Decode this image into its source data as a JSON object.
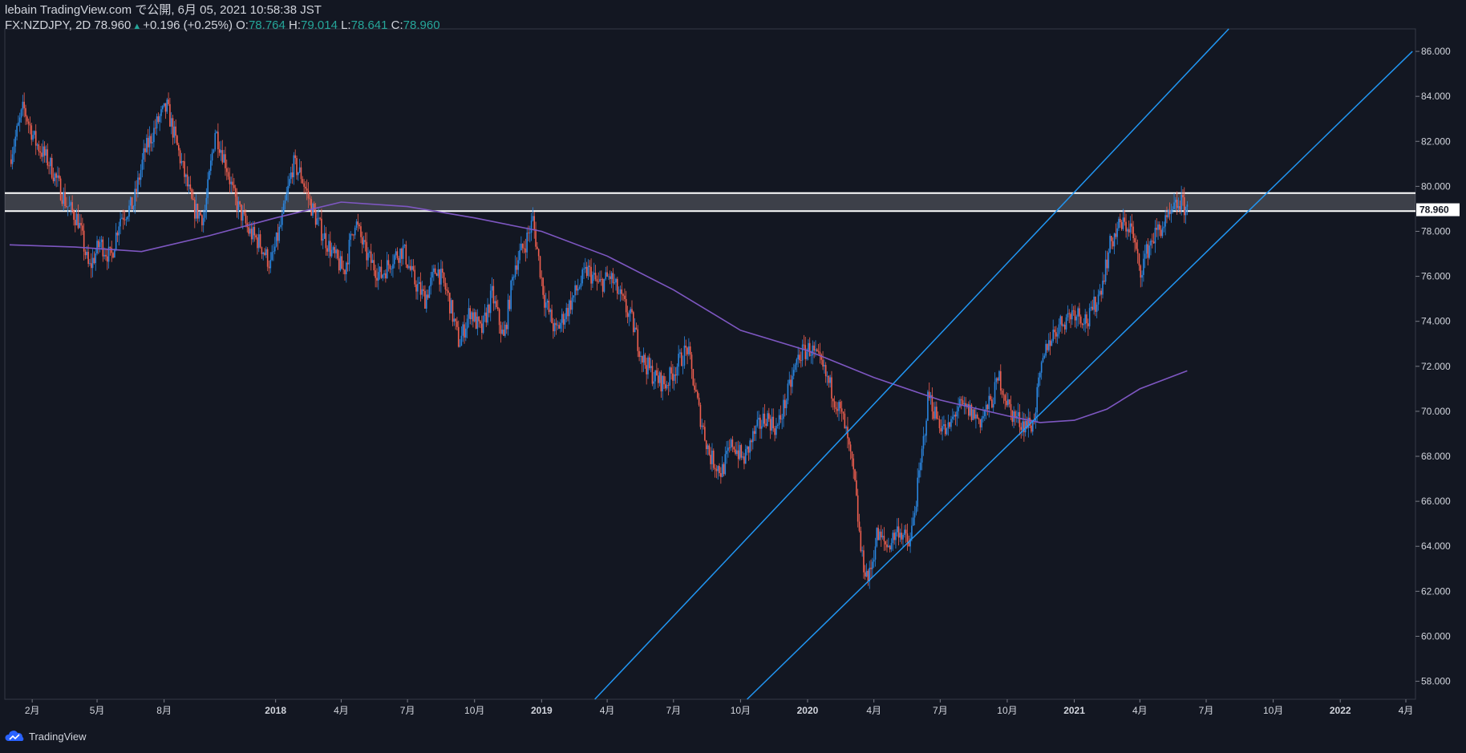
{
  "header": {
    "line1": "lebain TradingView.com で公開, 6月 05, 2021 10:58:38 JST",
    "symbol_tf": "FX:NZDJPY, 2D",
    "last": "78.960",
    "change": "+0.196 (+0.25%)",
    "o_label": "O:",
    "o_val": "78.764",
    "h_label": "H:",
    "h_val": "79.014",
    "l_label": "L:",
    "l_val": "78.641",
    "c_label": "C:",
    "c_val": "78.960"
  },
  "brand": "TradingView",
  "chart_data": {
    "type": "candlestick",
    "x_tick_labels": [
      "2月",
      "5月",
      "8月",
      "2018",
      "4月",
      "7月",
      "10月",
      "2019",
      "4月",
      "7月",
      "10月",
      "2020",
      "4月",
      "7月",
      "10月",
      "2021",
      "4月",
      "7月",
      "10月",
      "2022",
      "4月"
    ],
    "y_tick_labels": [
      "86.000",
      "84.000",
      "82.000",
      "80.000",
      "78.000",
      "76.000",
      "74.000",
      "72.000",
      "70.000",
      "68.000",
      "66.000",
      "64.000",
      "62.000",
      "60.000",
      "58.000"
    ],
    "ylim": [
      57.2,
      87.0
    ],
    "current_price_label": "78.960",
    "close_path": [
      [
        "2017-01-01",
        81.2
      ],
      [
        "2017-01-20",
        83.5
      ],
      [
        "2017-02-05",
        82.0
      ],
      [
        "2017-02-25",
        81.0
      ],
      [
        "2017-03-20",
        79.2
      ],
      [
        "2017-04-05",
        78.5
      ],
      [
        "2017-04-20",
        76.3
      ],
      [
        "2017-05-05",
        77.5
      ],
      [
        "2017-05-20",
        76.8
      ],
      [
        "2017-06-01",
        78.6
      ],
      [
        "2017-06-20",
        79.2
      ],
      [
        "2017-07-05",
        81.5
      ],
      [
        "2017-07-25",
        83.0
      ],
      [
        "2017-08-05",
        83.5
      ],
      [
        "2017-08-25",
        81.0
      ],
      [
        "2017-09-10",
        79.0
      ],
      [
        "2017-09-25",
        78.6
      ],
      [
        "2017-10-10",
        82.5
      ],
      [
        "2017-10-25",
        81.0
      ],
      [
        "2017-11-05",
        79.5
      ],
      [
        "2017-11-25",
        78.0
      ],
      [
        "2017-12-10",
        77.5
      ],
      [
        "2017-12-25",
        76.5
      ],
      [
        "2018-01-10",
        78.5
      ],
      [
        "2018-01-25",
        81.0
      ],
      [
        "2018-02-05",
        80.5
      ],
      [
        "2018-02-20",
        79.0
      ],
      [
        "2018-03-05",
        78.0
      ],
      [
        "2018-03-20",
        77.0
      ],
      [
        "2018-04-05",
        76.2
      ],
      [
        "2018-04-20",
        78.5
      ],
      [
        "2018-05-05",
        77.0
      ],
      [
        "2018-05-25",
        76.0
      ],
      [
        "2018-06-10",
        76.8
      ],
      [
        "2018-06-25",
        77.2
      ],
      [
        "2018-07-10",
        75.8
      ],
      [
        "2018-07-25",
        75.0
      ],
      [
        "2018-08-10",
        76.4
      ],
      [
        "2018-08-25",
        75.2
      ],
      [
        "2018-09-10",
        73.0
      ],
      [
        "2018-09-25",
        74.5
      ],
      [
        "2018-10-10",
        73.5
      ],
      [
        "2018-10-25",
        75.2
      ],
      [
        "2018-11-10",
        73.2
      ],
      [
        "2018-11-25",
        76.5
      ],
      [
        "2018-12-10",
        77.5
      ],
      [
        "2018-12-20",
        78.5
      ],
      [
        "2019-01-05",
        75.0
      ],
      [
        "2019-01-20",
        73.5
      ],
      [
        "2019-02-05",
        74.5
      ],
      [
        "2019-02-20",
        75.5
      ],
      [
        "2019-03-05",
        76.3
      ],
      [
        "2019-03-20",
        75.6
      ],
      [
        "2019-04-05",
        76.0
      ],
      [
        "2019-04-20",
        75.0
      ],
      [
        "2019-05-05",
        74.0
      ],
      [
        "2019-05-20",
        72.3
      ],
      [
        "2019-06-05",
        71.5
      ],
      [
        "2019-06-20",
        71.2
      ],
      [
        "2019-07-05",
        72.0
      ],
      [
        "2019-07-20",
        72.8
      ],
      [
        "2019-08-05",
        70.0
      ],
      [
        "2019-08-20",
        68.0
      ],
      [
        "2019-09-05",
        67.3
      ],
      [
        "2019-09-20",
        68.6
      ],
      [
        "2019-10-05",
        67.8
      ],
      [
        "2019-10-20",
        69.0
      ],
      [
        "2019-11-05",
        69.8
      ],
      [
        "2019-11-20",
        69.2
      ],
      [
        "2019-12-05",
        70.8
      ],
      [
        "2019-12-20",
        72.5
      ],
      [
        "2020-01-05",
        72.8
      ],
      [
        "2020-01-20",
        72.0
      ],
      [
        "2020-02-05",
        70.8
      ],
      [
        "2020-02-20",
        69.5
      ],
      [
        "2020-03-05",
        67.0
      ],
      [
        "2020-03-15",
        63.5
      ],
      [
        "2020-03-25",
        62.5
      ],
      [
        "2020-04-05",
        64.5
      ],
      [
        "2020-04-20",
        64.0
      ],
      [
        "2020-05-05",
        64.8
      ],
      [
        "2020-05-20",
        64.0
      ],
      [
        "2020-06-05",
        67.8
      ],
      [
        "2020-06-15",
        70.8
      ],
      [
        "2020-06-25",
        69.8
      ],
      [
        "2020-07-10",
        69.0
      ],
      [
        "2020-07-25",
        70.2
      ],
      [
        "2020-08-10",
        70.0
      ],
      [
        "2020-08-25",
        69.6
      ],
      [
        "2020-09-10",
        70.5
      ],
      [
        "2020-09-20",
        71.5
      ],
      [
        "2020-10-05",
        70.0
      ],
      [
        "2020-10-20",
        69.5
      ],
      [
        "2020-11-05",
        69.4
      ],
      [
        "2020-11-15",
        71.5
      ],
      [
        "2020-11-25",
        73.0
      ],
      [
        "2020-12-10",
        73.8
      ],
      [
        "2021-01-01",
        74.5
      ],
      [
        "2021-01-20",
        74.0
      ],
      [
        "2021-02-05",
        75.3
      ],
      [
        "2021-02-20",
        77.5
      ],
      [
        "2021-03-05",
        78.3
      ],
      [
        "2021-03-20",
        78.2
      ],
      [
        "2021-04-01",
        76.2
      ],
      [
        "2021-04-15",
        77.5
      ],
      [
        "2021-04-25",
        78.0
      ],
      [
        "2021-05-10",
        78.5
      ],
      [
        "2021-05-25",
        79.3
      ],
      [
        "2021-06-05",
        78.96
      ]
    ],
    "moving_average": [
      [
        "2017-01-01",
        77.4
      ],
      [
        "2017-04-01",
        77.3
      ],
      [
        "2017-07-01",
        77.1
      ],
      [
        "2017-10-01",
        77.8
      ],
      [
        "2018-01-01",
        78.6
      ],
      [
        "2018-04-01",
        79.3
      ],
      [
        "2018-07-01",
        79.1
      ],
      [
        "2018-10-01",
        78.6
      ],
      [
        "2019-01-01",
        78.0
      ],
      [
        "2019-04-01",
        76.9
      ],
      [
        "2019-07-01",
        75.4
      ],
      [
        "2019-10-01",
        73.6
      ],
      [
        "2020-01-01",
        72.7
      ],
      [
        "2020-04-01",
        71.5
      ],
      [
        "2020-07-01",
        70.5
      ],
      [
        "2020-10-01",
        69.8
      ],
      [
        "2020-11-15",
        69.5
      ],
      [
        "2021-01-01",
        69.6
      ],
      [
        "2021-02-15",
        70.1
      ],
      [
        "2021-04-01",
        71.0
      ],
      [
        "2021-06-05",
        71.8
      ]
    ],
    "horizontal_zone": [
      78.9,
      79.7
    ],
    "channel_lines": [
      [
        [
          "2019-03-15",
          57.2
        ],
        [
          "2021-08-01",
          87.0
        ]
      ],
      [
        [
          "2019-10-10",
          57.2
        ],
        [
          "2022-04-10",
          86.0
        ]
      ]
    ]
  }
}
